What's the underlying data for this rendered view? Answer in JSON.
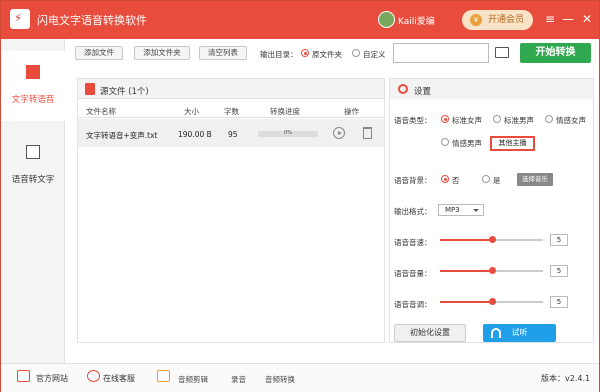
{
  "app": {
    "title": "闪电文字语音转换软件",
    "user_name": "Kaili爱编",
    "vip_label": "开通会员",
    "vip_glyph": "¥"
  },
  "window_controls": {
    "menu": "≡",
    "minimize": "—",
    "close": "✕"
  },
  "sidebar": {
    "items": [
      {
        "label": "文字转语音",
        "active": true
      },
      {
        "label": "语音转文字",
        "active": false
      }
    ]
  },
  "toolbar": {
    "add_file": "添加文件",
    "add_folder": "添加文件夹",
    "clear_list": "清空列表",
    "output_label": "输出目录：",
    "option_source": "原文件夹",
    "option_custom": "自定义",
    "path_value": "",
    "start_button": "开始转换"
  },
  "file_panel": {
    "title": "源文件 (1个)",
    "columns": [
      "文件名称",
      "大小",
      "字数",
      "转换进度",
      "操作"
    ],
    "rows": [
      {
        "name": "文字转语音+变声.txt",
        "size": "190.00 B",
        "words": "95",
        "progress": "0%"
      }
    ]
  },
  "settings": {
    "title": "设置",
    "voice_type_label": "语音类型：",
    "voice_options": [
      "标准女声",
      "标准男声",
      "情感女声",
      "情感男声"
    ],
    "selected_voice": "标准女声",
    "other_anchor": "其他主播",
    "bg_label": "语音背景：",
    "bg_no": "否",
    "bg_yes": "是",
    "bg_selected": "否",
    "choose_music": "选择音乐",
    "format_label": "输出格式：",
    "format_value": "MP3",
    "speed_label": "语音音速：",
    "speed_value": "5",
    "volume_label": "语音音量：",
    "volume_value": "5",
    "pitch_label": "语音音调：",
    "pitch_value": "5",
    "slider_max": 10,
    "reset_button": "初始化设置",
    "listen_button": "试听"
  },
  "footer": {
    "website": "官方网站",
    "service": "在线客服",
    "audio_cut": "音频剪辑",
    "record": "录音",
    "audio_convert": "音频转换",
    "version": "版本：v2.4.1"
  },
  "colors": {
    "accent": "#e84c3d",
    "start": "#2fa84f",
    "listen": "#1e9fe8"
  }
}
